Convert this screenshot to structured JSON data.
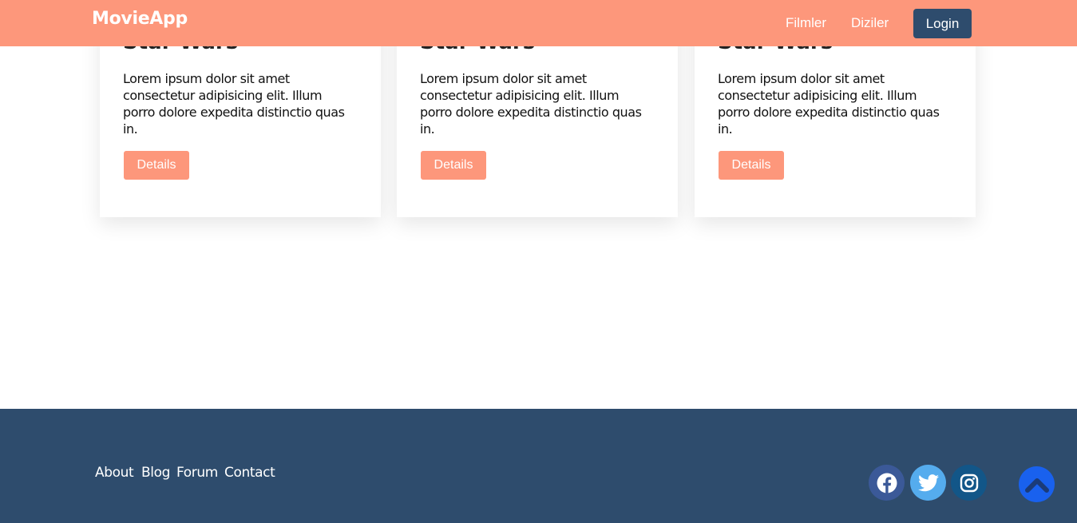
{
  "navbar": {
    "brand": "MovieApp",
    "links": [
      "Filmler",
      "Diziler"
    ],
    "login_label": "Login",
    "background": "#fd977b",
    "login_background": "#2e4c6d"
  },
  "cards": [
    {
      "title": "Star Wars",
      "text": "Lorem ipsum dolor sit amet consectetur adipisicing elit. Illum porro dolore expedita distinctio quas in.",
      "button": "Details"
    },
    {
      "title": "Star Wars",
      "text": "Lorem ipsum dolor sit amet consectetur adipisicing elit. Illum porro dolore expedita distinctio quas in.",
      "button": "Details"
    },
    {
      "title": "Star Wars",
      "text": "Lorem ipsum dolor sit amet consectetur adipisicing elit. Illum porro dolore expedita distinctio quas in.",
      "button": "Details"
    }
  ],
  "footer": {
    "links": [
      "About",
      "Blog",
      "Forum",
      "Contact"
    ],
    "background": "#2e4c6d",
    "social": [
      {
        "icon": "facebook-icon",
        "color": "#3b5998"
      },
      {
        "icon": "twitter-icon",
        "color": "#55acee"
      },
      {
        "icon": "instagram-icon",
        "color": "#125688"
      }
    ],
    "scroll_top_icon": "chevron-up-icon",
    "scroll_top_color": "#1961ee"
  }
}
